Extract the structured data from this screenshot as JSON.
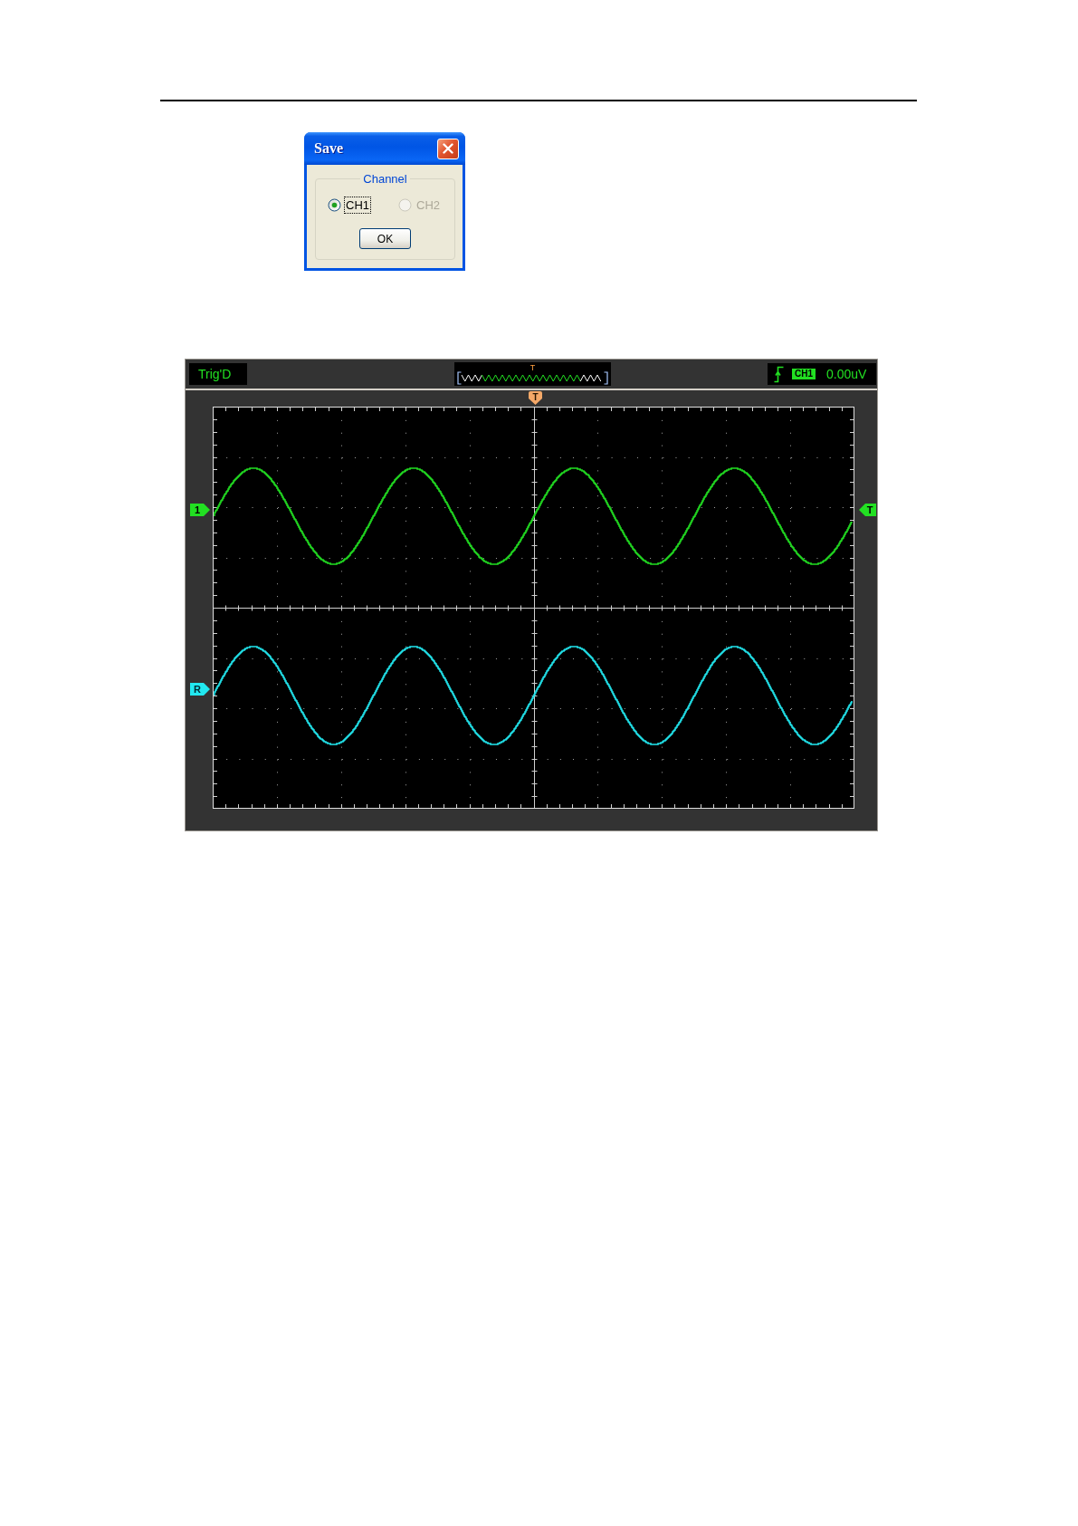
{
  "save_dialog": {
    "title": "Save",
    "group_label": "Channel",
    "options": [
      {
        "label": "CH1",
        "selected": true,
        "disabled": false,
        "focused": true
      },
      {
        "label": "CH2",
        "selected": false,
        "disabled": true,
        "focused": false
      }
    ],
    "button": "OK"
  },
  "scope": {
    "status": "Trig'D",
    "overview_marker": "T",
    "trigger_source": "CH1",
    "trigger_level": "0.00uV",
    "markers": [
      {
        "kind": "trigger-position",
        "label": "T",
        "color": "#f4a868"
      },
      {
        "kind": "channel",
        "label": "1",
        "color": "#22e022"
      },
      {
        "kind": "reference",
        "label": "R",
        "color": "#22e8f0"
      },
      {
        "kind": "trigger-level",
        "label": "T",
        "color": "#22e022"
      }
    ]
  }
}
